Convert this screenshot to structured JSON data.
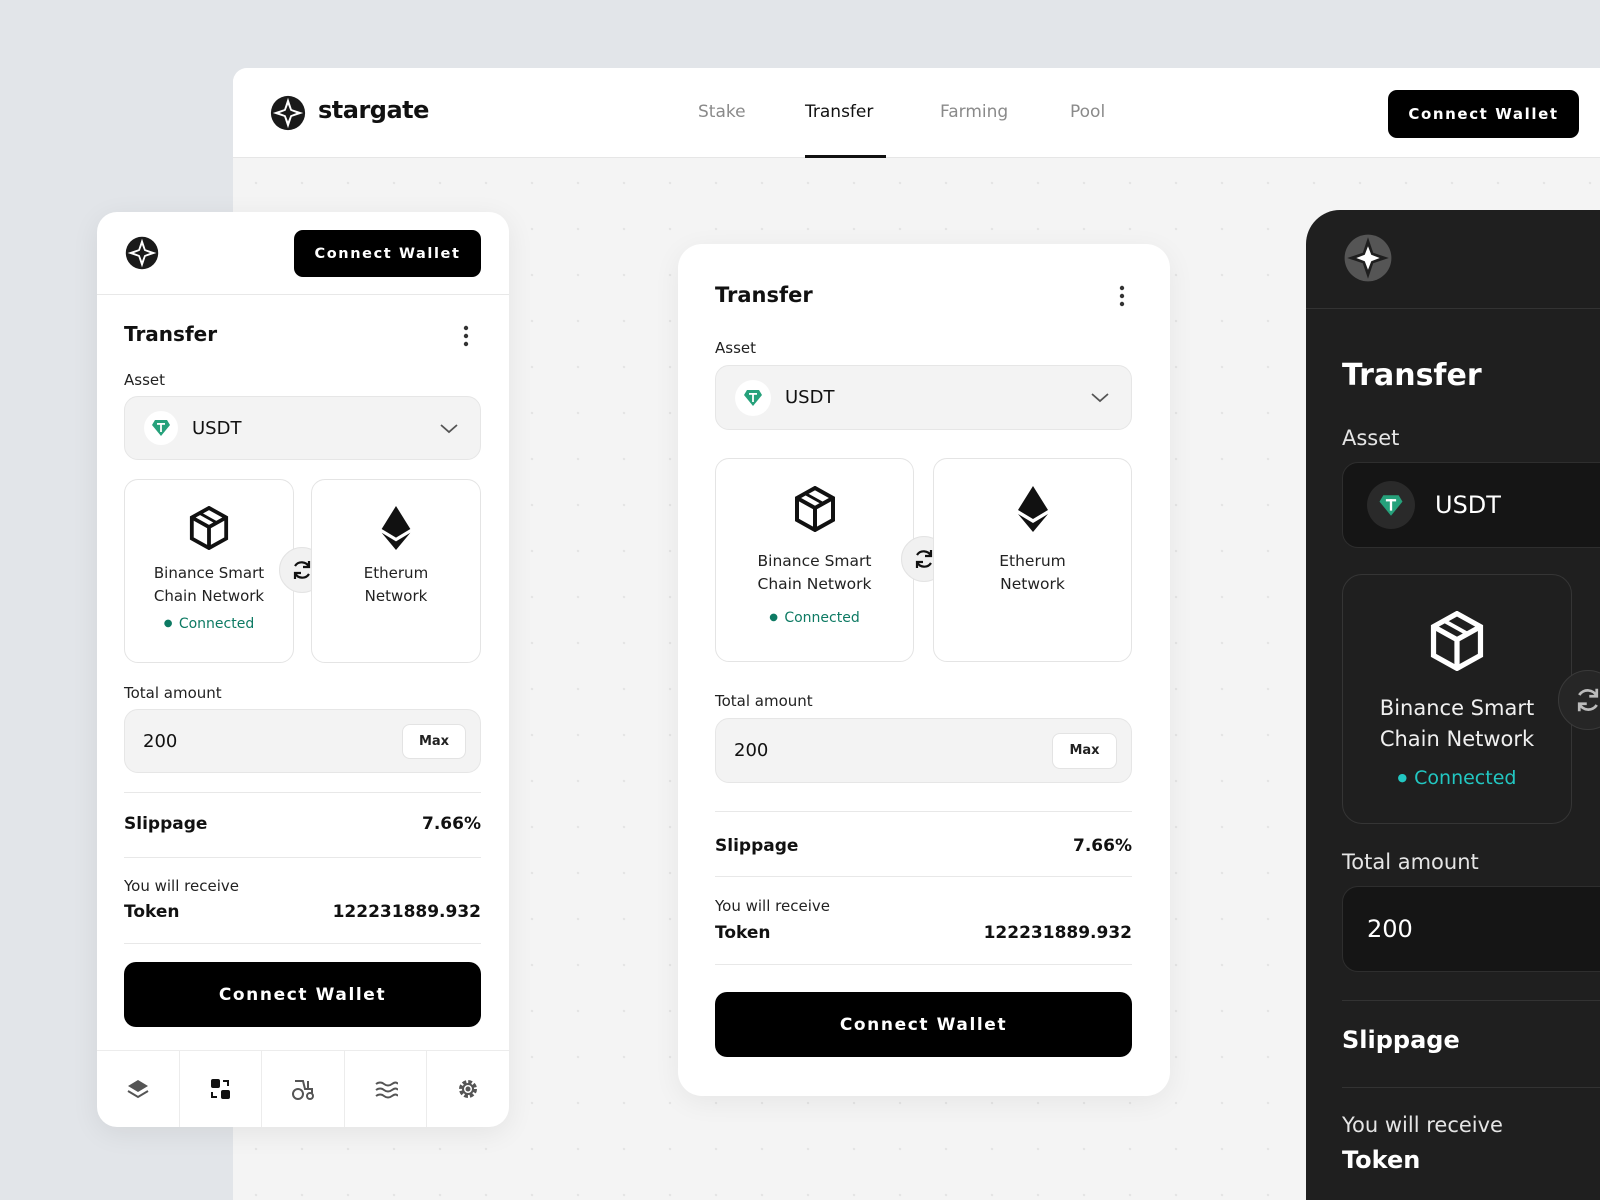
{
  "brand": {
    "name": "stargate"
  },
  "nav": {
    "items": [
      "Stake",
      "Transfer",
      "Farming",
      "Pool"
    ],
    "active": "Transfer"
  },
  "header": {
    "connect_label": "Connect Wallet"
  },
  "transfer": {
    "title": "Transfer",
    "asset_label": "Asset",
    "asset_value": "USDT",
    "source_network": {
      "name_line1": "Binance Smart",
      "name_line2": "Chain Network",
      "status": "Connected"
    },
    "target_network": {
      "name_line1": "Etherum",
      "name_line2": "Network"
    },
    "amount_label": "Total amount",
    "amount_value": "200",
    "max_label": "Max",
    "slippage_label": "Slippage",
    "slippage_value": "7.66%",
    "receive_label": "You will receive",
    "token_label": "Token",
    "token_value": "122231889.932",
    "connect_label": "Connect Wallet"
  },
  "mobile": {
    "connect_label": "Connect Wallet"
  },
  "colors": {
    "accent_connected": "#0d7a63",
    "accent_connected_dark": "#22c7c2",
    "tether": "#26a17b"
  }
}
